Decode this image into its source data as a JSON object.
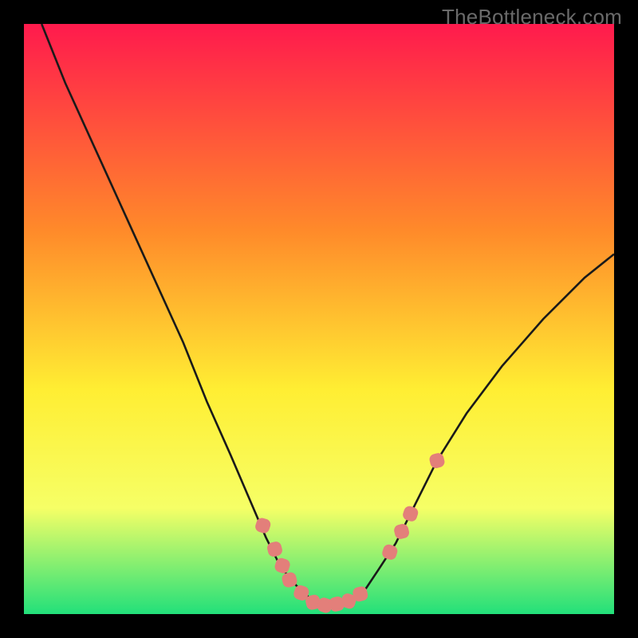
{
  "watermark": "TheBottleneck.com",
  "chart_data": {
    "type": "line",
    "title": "",
    "xlabel": "",
    "ylabel": "",
    "xlim": [
      0,
      100
    ],
    "ylim": [
      0,
      100
    ],
    "series": [
      {
        "name": "curve",
        "x": [
          3,
          7,
          12,
          17,
          22,
          27,
          31,
          35,
          38,
          41,
          43,
          45,
          47,
          49,
          50,
          52,
          54,
          56,
          58,
          60,
          63,
          66,
          70,
          75,
          81,
          88,
          95,
          100
        ],
        "y": [
          100,
          90,
          79,
          68,
          57,
          46,
          36,
          27,
          20,
          13,
          9,
          6,
          4,
          2.2,
          1.6,
          1.5,
          1.8,
          2.6,
          4.4,
          7.4,
          12,
          18,
          26,
          34,
          42,
          50,
          57,
          61
        ]
      }
    ],
    "markers": [
      {
        "x": 40.5,
        "y": 15
      },
      {
        "x": 42.5,
        "y": 11
      },
      {
        "x": 43.8,
        "y": 8.2
      },
      {
        "x": 45.0,
        "y": 5.8
      },
      {
        "x": 47.0,
        "y": 3.6
      },
      {
        "x": 49.0,
        "y": 2.0
      },
      {
        "x": 51.0,
        "y": 1.5
      },
      {
        "x": 53.0,
        "y": 1.7
      },
      {
        "x": 55.0,
        "y": 2.2
      },
      {
        "x": 57.0,
        "y": 3.4
      },
      {
        "x": 62.0,
        "y": 10.5
      },
      {
        "x": 64.0,
        "y": 14.0
      },
      {
        "x": 65.5,
        "y": 17.0
      },
      {
        "x": 70.0,
        "y": 26.0
      }
    ],
    "background_gradient": {
      "top": "#ff1a4d",
      "mid1": "#ff8a2a",
      "mid2": "#ffee33",
      "low": "#f6ff66",
      "bottom": "#22e07a"
    },
    "marker_color": "#e37f7a",
    "curve_color": "#1a1a1a"
  }
}
